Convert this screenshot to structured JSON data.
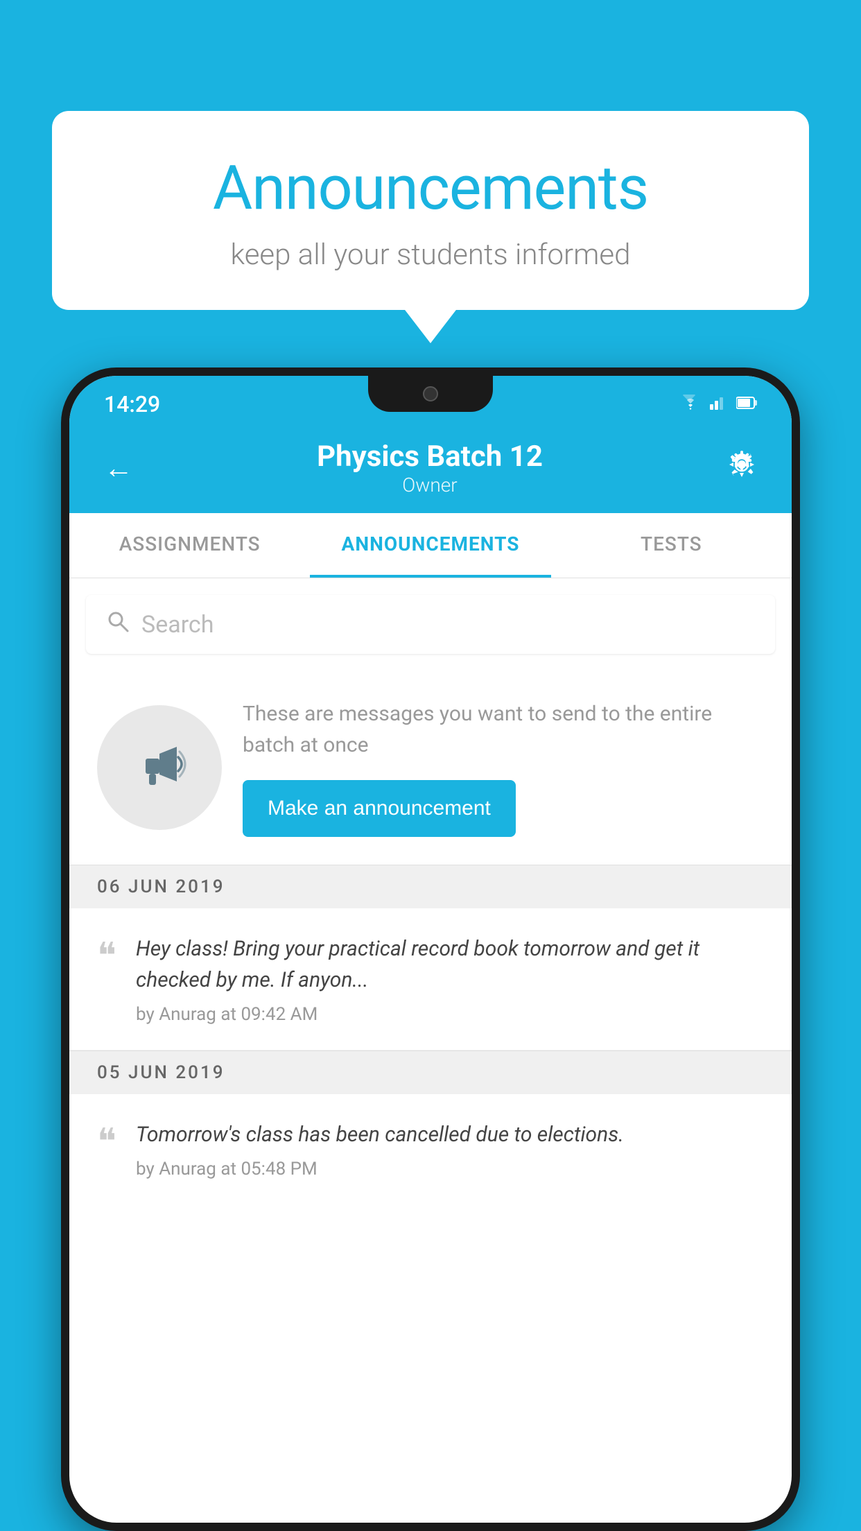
{
  "background_color": "#1ab3e0",
  "speech_bubble": {
    "title": "Announcements",
    "subtitle": "keep all your students informed"
  },
  "phone": {
    "status_bar": {
      "time": "14:29",
      "wifi": "▼",
      "signal": "▲",
      "battery": "▮"
    },
    "header": {
      "back_label": "←",
      "title": "Physics Batch 12",
      "subtitle": "Owner",
      "settings_label": "⚙"
    },
    "tabs": [
      {
        "label": "ASSIGNMENTS",
        "active": false
      },
      {
        "label": "ANNOUNCEMENTS",
        "active": true
      },
      {
        "label": "TESTS",
        "active": false
      }
    ],
    "search": {
      "placeholder": "Search"
    },
    "prompt": {
      "description": "These are messages you want to send to the entire batch at once",
      "button_label": "Make an announcement"
    },
    "announcements": [
      {
        "date": "06  JUN  2019",
        "text": "Hey class! Bring your practical record book tomorrow and get it checked by me. If anyon...",
        "meta": "by Anurag at 09:42 AM"
      },
      {
        "date": "05  JUN  2019",
        "text": "Tomorrow's class has been cancelled due to elections.",
        "meta": "by Anurag at 05:48 PM"
      }
    ]
  }
}
